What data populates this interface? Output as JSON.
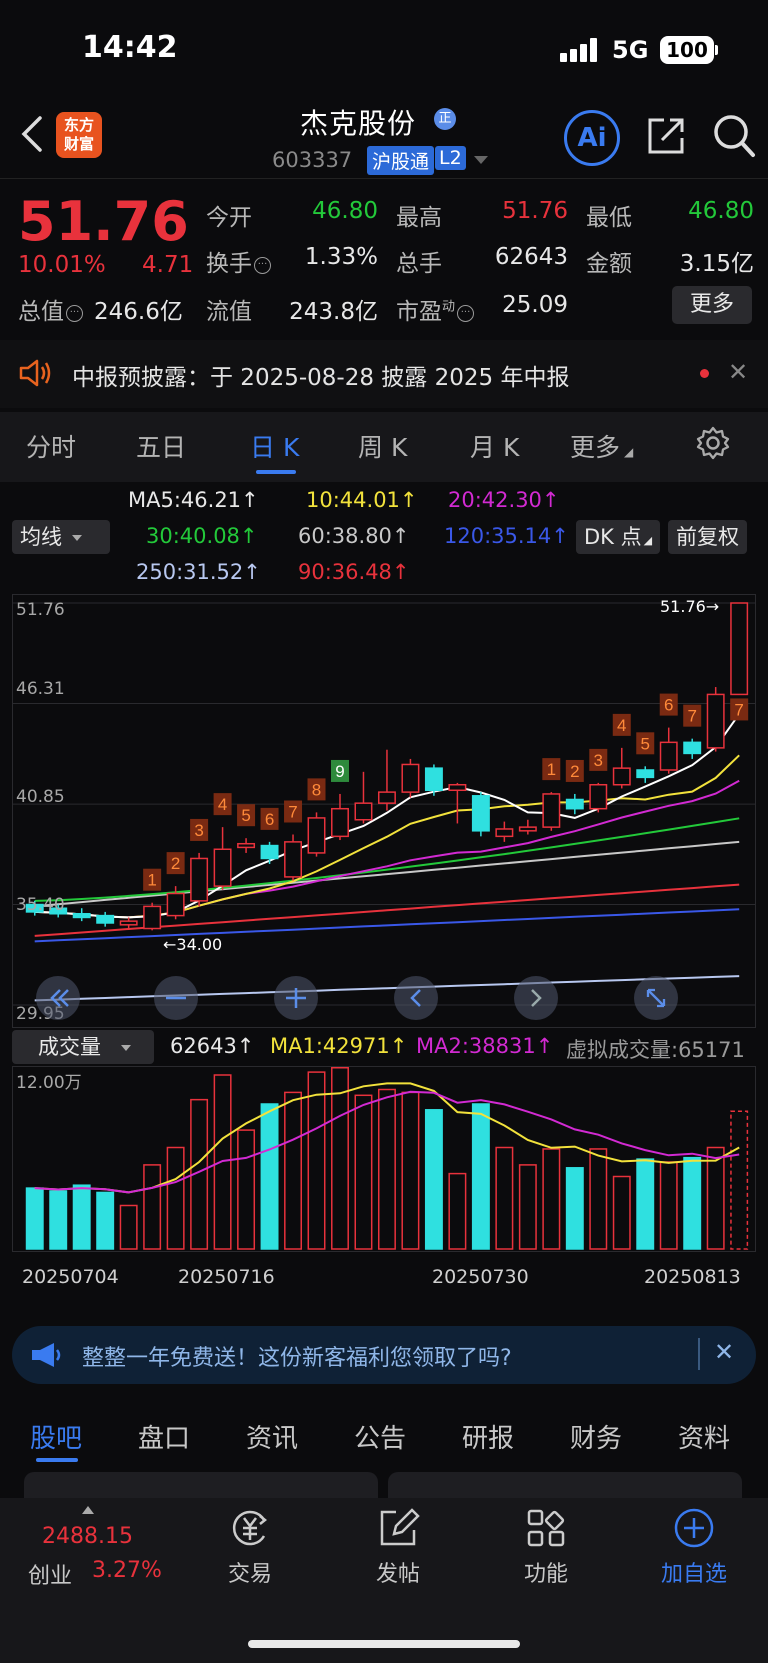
{
  "status": {
    "time": "14:42",
    "network": "5G",
    "battery": "100"
  },
  "header": {
    "logo_line1": "东方",
    "logo_line2": "财富",
    "name": "杰克股份",
    "badge": "正",
    "code": "603337",
    "tag1": "沪股通",
    "tag2": "L2"
  },
  "quote": {
    "price": "51.76",
    "change_pct": "10.01%",
    "change_amt": "4.71",
    "open_label": "今开",
    "open": "46.80",
    "high_label": "最高",
    "high": "51.76",
    "low_label": "最低",
    "low": "46.80",
    "turnover_label": "换手",
    "turnover": "1.33%",
    "volume_label": "总手",
    "volume": "62643",
    "amount_label": "金额",
    "amount": "3.15亿",
    "mktcap_label": "总值",
    "mktcap": "246.6亿",
    "float_label": "流值",
    "float": "243.8亿",
    "pe_label": "市盈",
    "pe_sup": "动",
    "pe": "25.09",
    "more": "更多"
  },
  "notice": {
    "text": "中报预披露：于 2025-08-28 披露 2025 年中报"
  },
  "tabs": [
    "分时",
    "五日",
    "日 K",
    "周 K",
    "月 K",
    "更多"
  ],
  "ma_legend": {
    "selector": "均线",
    "ma5": "MA5:46.21↑",
    "ma10": "10:44.01↑",
    "ma20": "20:42.30↑",
    "ma30": "30:40.08↑",
    "ma60": "60:38.80↑",
    "ma120": "120:35.14↑",
    "ma250": "250:31.52↑",
    "ma90": "90:36.48↑",
    "dk": "DK 点",
    "adjust": "前复权"
  },
  "chart_labels": {
    "y_top": "51.76",
    "y2": "46.31",
    "y3": "40.85",
    "y4": "35.40",
    "y_bottom": "29.95",
    "high_mark": "51.76→",
    "low_mark": "←34.00"
  },
  "volume": {
    "selector": "成交量",
    "value": "62643↑",
    "ma1": "MA1:42971↑",
    "ma2": "MA2:38831↑",
    "virtual": "虚拟成交量:65171",
    "y_top": "12.00万"
  },
  "dates": [
    "20250704",
    "20250716",
    "20250730",
    "20250813"
  ],
  "chart_data": {
    "type": "candlestick",
    "ylim": [
      29.95,
      51.76
    ],
    "y_ticks": [
      51.76,
      46.31,
      40.85,
      35.4,
      29.95
    ],
    "candles": [
      {
        "o": 35.4,
        "c": 35.0,
        "h": 35.6,
        "l": 34.8
      },
      {
        "o": 35.2,
        "c": 34.9,
        "h": 35.4,
        "l": 34.7
      },
      {
        "o": 34.9,
        "c": 34.7,
        "h": 35.2,
        "l": 34.5
      },
      {
        "o": 34.8,
        "c": 34.4,
        "h": 35.0,
        "l": 34.2
      },
      {
        "o": 34.3,
        "c": 34.5,
        "h": 34.7,
        "l": 34.1
      },
      {
        "o": 34.1,
        "c": 35.3,
        "h": 35.5,
        "l": 34.0
      },
      {
        "o": 34.8,
        "c": 36.0,
        "h": 36.4,
        "l": 34.6
      },
      {
        "o": 35.6,
        "c": 37.9,
        "h": 38.2,
        "l": 35.3
      },
      {
        "o": 36.4,
        "c": 38.4,
        "h": 39.6,
        "l": 36.2
      },
      {
        "o": 38.5,
        "c": 38.7,
        "h": 39.0,
        "l": 38.2
      },
      {
        "o": 38.6,
        "c": 37.9,
        "h": 38.8,
        "l": 37.6
      },
      {
        "o": 36.9,
        "c": 38.8,
        "h": 39.2,
        "l": 36.7
      },
      {
        "o": 38.2,
        "c": 40.1,
        "h": 40.4,
        "l": 38.0
      },
      {
        "o": 39.1,
        "c": 40.6,
        "h": 41.4,
        "l": 38.9
      },
      {
        "o": 40.0,
        "c": 40.9,
        "h": 42.6,
        "l": 39.8
      },
      {
        "o": 40.9,
        "c": 41.5,
        "h": 43.8,
        "l": 40.5
      },
      {
        "o": 41.5,
        "c": 43.0,
        "h": 43.3,
        "l": 41.2
      },
      {
        "o": 42.8,
        "c": 41.6,
        "h": 43.0,
        "l": 41.3
      },
      {
        "o": 41.6,
        "c": 41.9,
        "h": 42.0,
        "l": 39.8
      },
      {
        "o": 41.3,
        "c": 39.4,
        "h": 41.5,
        "l": 39.1
      },
      {
        "o": 39.1,
        "c": 39.5,
        "h": 39.9,
        "l": 38.8
      },
      {
        "o": 39.4,
        "c": 39.6,
        "h": 40.0,
        "l": 39.2
      },
      {
        "o": 39.6,
        "c": 41.4,
        "h": 41.5,
        "l": 39.4
      },
      {
        "o": 41.1,
        "c": 40.6,
        "h": 41.4,
        "l": 40.3
      },
      {
        "o": 40.6,
        "c": 41.9,
        "h": 42.0,
        "l": 40.4
      },
      {
        "o": 41.9,
        "c": 42.8,
        "h": 43.9,
        "l": 41.7
      },
      {
        "o": 42.7,
        "c": 42.3,
        "h": 42.9,
        "l": 42.0
      },
      {
        "o": 42.7,
        "c": 44.2,
        "h": 45.0,
        "l": 42.5
      },
      {
        "o": 44.2,
        "c": 43.6,
        "h": 44.4,
        "l": 43.3
      },
      {
        "o": 43.9,
        "c": 46.8,
        "h": 47.2,
        "l": 43.7
      },
      {
        "o": 46.8,
        "c": 51.76,
        "h": 51.76,
        "l": 46.8
      }
    ],
    "td_counts": [
      null,
      null,
      null,
      null,
      null,
      "1",
      "2",
      "3",
      "4",
      "5",
      "6",
      "7",
      "8",
      "9",
      null,
      null,
      null,
      null,
      null,
      null,
      null,
      null,
      "1",
      "2",
      "3",
      "4",
      "5",
      "6",
      "7",
      null,
      null
    ],
    "volume": [
      42000,
      40000,
      44000,
      39000,
      30000,
      58000,
      70000,
      103000,
      120000,
      82000,
      100000,
      108000,
      122000,
      125000,
      106000,
      110000,
      108000,
      96000,
      52000,
      100000,
      70000,
      58000,
      69000,
      56000,
      69000,
      50000,
      62000,
      60000,
      63000,
      70000,
      95000
    ]
  },
  "banner": {
    "text": "整整一年免费送！这份新客福利您领取了吗?"
  },
  "bottom_tabs": [
    "股吧",
    "盘口",
    "资讯",
    "公告",
    "研报",
    "财务",
    "资料"
  ],
  "toolbar": {
    "index_value": "2488.15",
    "index_name": "创业",
    "index_pct": "3.27%",
    "trade": "交易",
    "post": "发帖",
    "function": "功能",
    "watch": "加自选"
  },
  "colors": {
    "up": "#e8323c",
    "down": "#2fe0e0",
    "accent": "#3a7bf0"
  }
}
